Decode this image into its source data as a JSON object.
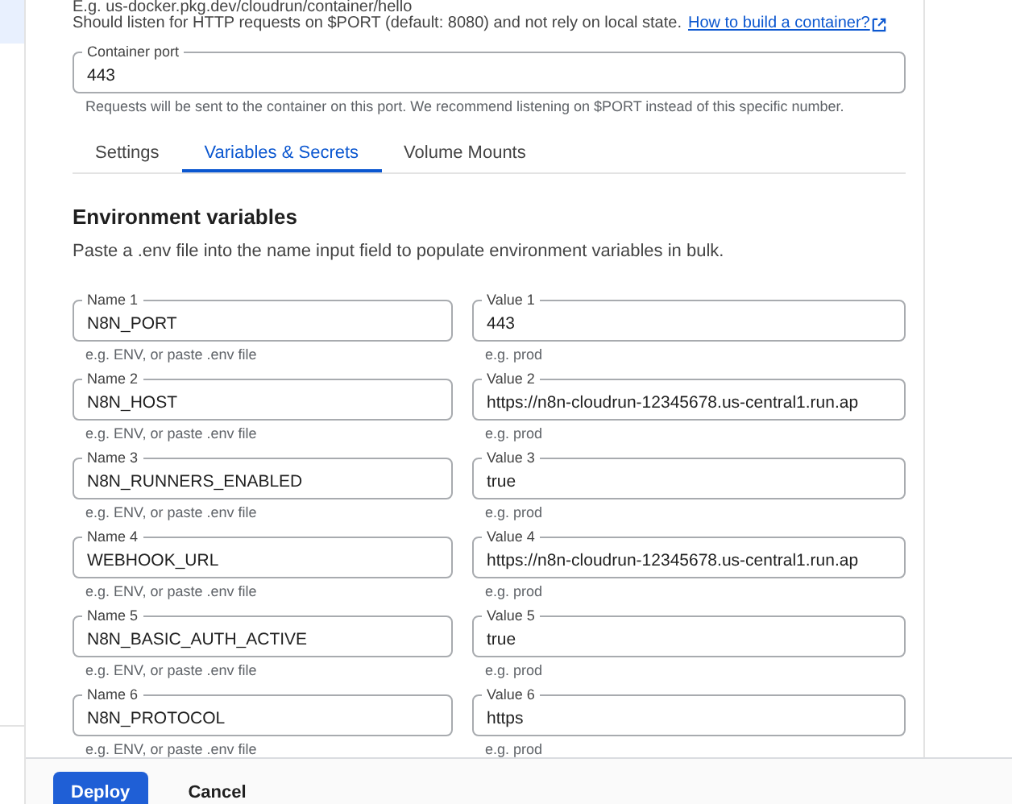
{
  "image_hint": "E.g. us-docker.pkg.dev/cloudrun/container/hello",
  "image_help": {
    "text": "Should listen for HTTP requests on $PORT (default: 8080) and not rely on local state.",
    "link": "How to build a container?"
  },
  "container_port": {
    "label": "Container port",
    "value": "443",
    "helper": "Requests will be sent to the container on this port. We recommend listening on $PORT instead of this specific number."
  },
  "tabs": [
    {
      "label": "Settings",
      "selected": false
    },
    {
      "label": "Variables & Secrets",
      "selected": true
    },
    {
      "label": "Volume Mounts",
      "selected": false
    }
  ],
  "env": {
    "title": "Environment variables",
    "description": "Paste a .env file into the name input field to populate environment variables in bulk.",
    "rows": [
      {
        "name": {
          "label": "Name 1",
          "value": "N8N_PORT",
          "helper": "e.g. ENV, or paste .env file"
        },
        "value": {
          "label": "Value 1",
          "value": "443",
          "helper": "e.g. prod"
        }
      },
      {
        "name": {
          "label": "Name 2",
          "value": "N8N_HOST",
          "helper": "e.g. ENV, or paste .env file"
        },
        "value": {
          "label": "Value 2",
          "value": "https://n8n-cloudrun-12345678.us-central1.run.ap",
          "helper": "e.g. prod"
        }
      },
      {
        "name": {
          "label": "Name 3",
          "value": "N8N_RUNNERS_ENABLED",
          "helper": "e.g. ENV, or paste .env file"
        },
        "value": {
          "label": "Value 3",
          "value": "true",
          "helper": "e.g. prod"
        }
      },
      {
        "name": {
          "label": "Name 4",
          "value": "WEBHOOK_URL",
          "helper": "e.g. ENV, or paste .env file"
        },
        "value": {
          "label": "Value 4",
          "value": "https://n8n-cloudrun-12345678.us-central1.run.ap",
          "helper": "e.g. prod"
        }
      },
      {
        "name": {
          "label": "Name 5",
          "value": "N8N_BASIC_AUTH_ACTIVE",
          "helper": "e.g. ENV, or paste .env file"
        },
        "value": {
          "label": "Value 5",
          "value": "true",
          "helper": "e.g. prod"
        }
      },
      {
        "name": {
          "label": "Name 6",
          "value": "N8N_PROTOCOL",
          "helper": "e.g. ENV, or paste .env file"
        },
        "value": {
          "label": "Value 6",
          "value": "https",
          "helper": "e.g. prod"
        }
      }
    ]
  },
  "footer": {
    "buttons": [
      {
        "label": "Deploy",
        "kind": "primary"
      },
      {
        "label": "Cancel",
        "kind": "text"
      }
    ]
  }
}
